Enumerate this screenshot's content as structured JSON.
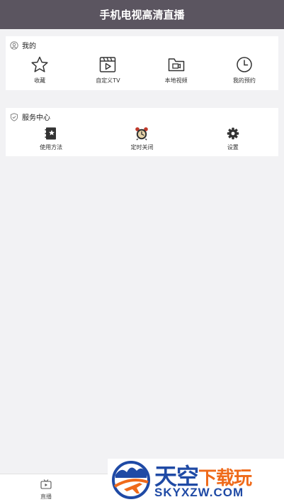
{
  "header": {
    "title": "手机电视高清直播"
  },
  "mine": {
    "title": "我的",
    "items": [
      {
        "label": "收藏",
        "icon": "star-icon"
      },
      {
        "label": "自定义TV",
        "icon": "clapperboard-icon"
      },
      {
        "label": "本地视频",
        "icon": "video-folder-icon"
      },
      {
        "label": "我的预约",
        "icon": "clock-icon"
      }
    ]
  },
  "service": {
    "title": "服务中心",
    "items": [
      {
        "label": "使用方法",
        "icon": "guide-book-icon"
      },
      {
        "label": "定时关闭",
        "icon": "alarm-clock-icon"
      },
      {
        "label": "设置",
        "icon": "gear-icon"
      }
    ]
  },
  "bottom_nav": {
    "live_label": "直播"
  },
  "watermark": {
    "line1_blue": "天空",
    "line1_orange": "下载玩",
    "line2": "SKYXZW.COM"
  },
  "colors": {
    "header_bg": "#5b5560",
    "page_bg": "#f2f2f4",
    "icon": "#333333",
    "alarm_accent": "#c0392b",
    "watermark_blue": "#1f4aa5",
    "watermark_orange": "#ef6a1a"
  }
}
